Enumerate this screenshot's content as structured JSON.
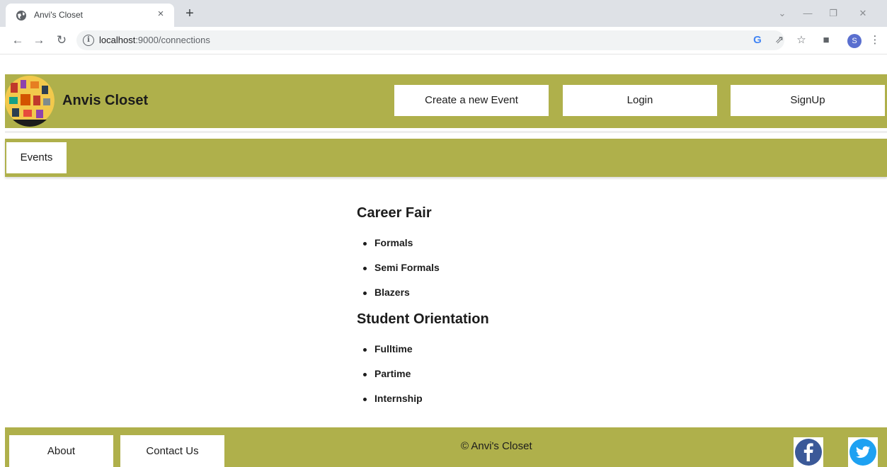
{
  "browser": {
    "tab_title": "Anvi's Closet",
    "tab_close": "×",
    "new_tab": "+",
    "url_host": "localhost",
    "url_rest": ":9000/connections",
    "profile_initial": "S"
  },
  "header": {
    "site_title": "Anvis Closet",
    "buttons": {
      "create_event": "Create a new Event",
      "login": "Login",
      "signup": "SignUp"
    }
  },
  "subnav": {
    "events": "Events"
  },
  "categories": [
    {
      "title": "Career Fair",
      "items": [
        "Formals",
        "Semi Formals",
        "Blazers"
      ]
    },
    {
      "title": "Student Orientation",
      "items": [
        "Fulltime",
        "Partime",
        "Internship"
      ]
    }
  ],
  "footer": {
    "about": "About",
    "contact": "Contact Us",
    "copyright": "© Anvi's Closet",
    "social": [
      "facebook-icon",
      "twitter-icon"
    ]
  },
  "colors": {
    "brand_olive": "#afb04b",
    "facebook": "#3b5998",
    "twitter": "#1da1f2"
  }
}
